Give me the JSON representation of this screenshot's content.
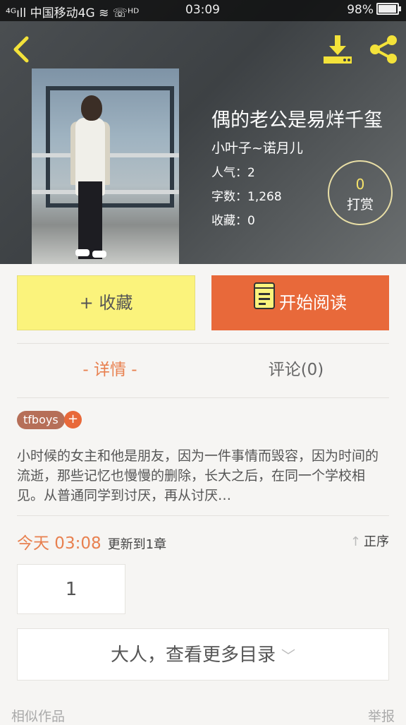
{
  "status_bar": {
    "left": "⁴ᴳıll 中国移动4G ≋ ☏ᴴᴰ",
    "time": "03:09",
    "battery": "98%"
  },
  "book": {
    "title": "偶的老公是易烊千玺",
    "author": "小叶子~诺月儿",
    "popularity": "人气：2",
    "word_count": "字数：1,268",
    "favorites": "收藏：0"
  },
  "tip": {
    "count": "0",
    "label": "打赏"
  },
  "actions": {
    "favorite": "+ 收藏",
    "read": "开始阅读"
  },
  "tabs": {
    "detail": "- 详情 -",
    "comment": "评论(0)"
  },
  "tags": [
    "tfboys"
  ],
  "tag_add": "+",
  "description": "小时候的女主和他是朋友，因为一件事情而毁容，因为时间的流逝，那些记忆也慢慢的删除，长大之后，在同一个学校相见。从普通同学到讨厌，再从讨厌…",
  "update": {
    "time": "今天 03:08",
    "info": "更新到1章",
    "sort": "正序"
  },
  "chapters": [
    "1"
  ],
  "more_catalog": "大人，查看更多目录",
  "footer": {
    "similar": "相似作品",
    "report": "举报"
  },
  "colors": {
    "accent": "#e8693a",
    "fav_button": "#fbf37c",
    "icon_yellow": "#f3e23a"
  }
}
